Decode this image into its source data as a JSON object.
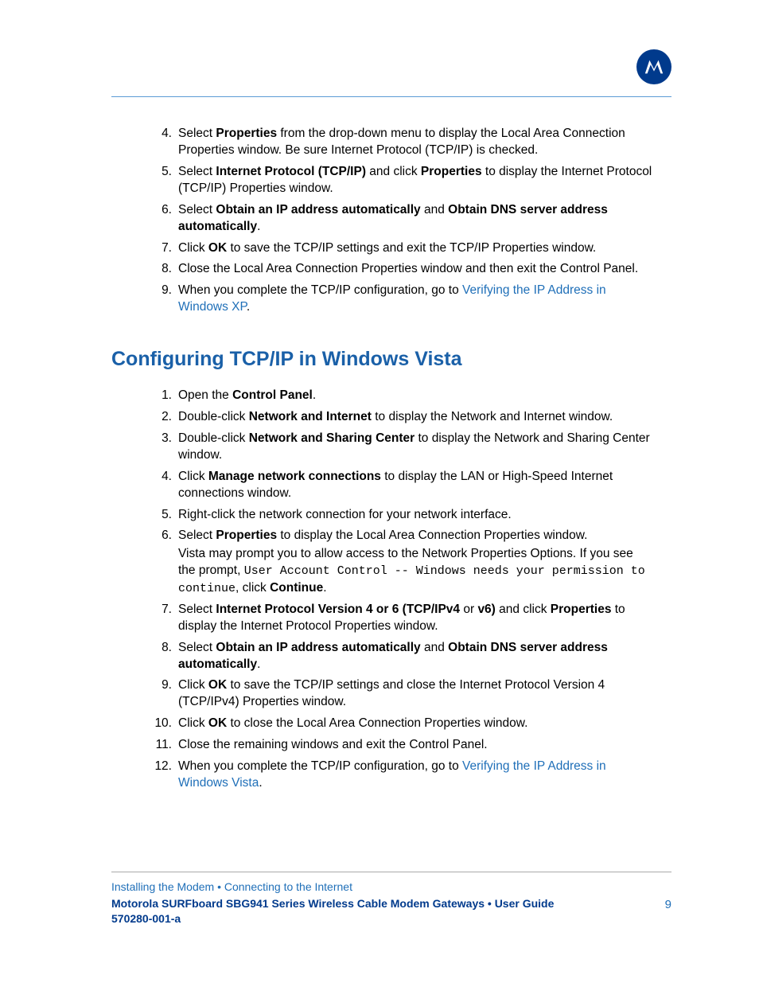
{
  "xp_steps": [
    {
      "n": "4.",
      "parts": [
        {
          "t": "Select "
        },
        {
          "t": "Properties",
          "b": 1
        },
        {
          "t": " from the drop-down menu to display the Local Area Connection Properties window. Be sure Internet Protocol (TCP/IP) is checked."
        }
      ]
    },
    {
      "n": "5.",
      "parts": [
        {
          "t": "Select "
        },
        {
          "t": "Internet Protocol (TCP/IP)",
          "b": 1
        },
        {
          "t": " and click "
        },
        {
          "t": "Properties",
          "b": 1
        },
        {
          "t": " to display the Internet Protocol (TCP/IP) Properties window."
        }
      ]
    },
    {
      "n": "6.",
      "parts": [
        {
          "t": "Select "
        },
        {
          "t": "Obtain an IP address automatically",
          "b": 1
        },
        {
          "t": " and "
        },
        {
          "t": "Obtain DNS server address automatically",
          "b": 1
        },
        {
          "t": "."
        }
      ]
    },
    {
      "n": "7.",
      "parts": [
        {
          "t": "Click "
        },
        {
          "t": "OK",
          "b": 1
        },
        {
          "t": " to save the TCP/IP settings and exit the TCP/IP Properties window."
        }
      ]
    },
    {
      "n": "8.",
      "parts": [
        {
          "t": "Close the Local Area Connection Properties window and then exit the Control Panel."
        }
      ]
    },
    {
      "n": "9.",
      "parts": [
        {
          "t": "When you complete the TCP/IP configuration, go to "
        },
        {
          "t": "Verifying the IP Address in Windows XP",
          "link": 1
        },
        {
          "t": "."
        }
      ]
    }
  ],
  "section_heading": "Configuring TCP/IP in Windows Vista",
  "vista_steps": [
    {
      "n": "1.",
      "parts": [
        {
          "t": "Open the "
        },
        {
          "t": "Control Panel",
          "b": 1
        },
        {
          "t": "."
        }
      ]
    },
    {
      "n": "2.",
      "parts": [
        {
          "t": "Double-click "
        },
        {
          "t": "Network and Internet",
          "b": 1
        },
        {
          "t": " to display the Network and Internet window."
        }
      ]
    },
    {
      "n": "3.",
      "parts": [
        {
          "t": "Double-click "
        },
        {
          "t": "Network and Sharing Center",
          "b": 1
        },
        {
          "t": " to display the Network and Sharing Center window."
        }
      ]
    },
    {
      "n": "4.",
      "parts": [
        {
          "t": "Click "
        },
        {
          "t": "Manage network connections",
          "b": 1
        },
        {
          "t": " to display the LAN or High-Speed Internet connections window."
        }
      ]
    },
    {
      "n": "5.",
      "parts": [
        {
          "t": "Right-click the network connection for your network interface."
        }
      ]
    },
    {
      "n": "6.",
      "parts": [
        {
          "t": "Select "
        },
        {
          "t": "Properties",
          "b": 1
        },
        {
          "t": " to display the Local Area Connection Properties window."
        }
      ],
      "sub": [
        {
          "t": "Vista may prompt you to allow access to the Network Properties Options. If you see the prompt, "
        },
        {
          "t": "User Account Control -- Windows needs your permission to continue",
          "mono": 1
        },
        {
          "t": ", click "
        },
        {
          "t": "Continue",
          "b": 1
        },
        {
          "t": "."
        }
      ]
    },
    {
      "n": "7.",
      "parts": [
        {
          "t": "Select "
        },
        {
          "t": "Internet Protocol Version 4 or 6 (TCP/IPv4",
          "b": 1
        },
        {
          "t": " or "
        },
        {
          "t": "v6)",
          "b": 1
        },
        {
          "t": " and click "
        },
        {
          "t": "Properties",
          "b": 1
        },
        {
          "t": " to display the Internet Protocol Properties window."
        }
      ]
    },
    {
      "n": "8.",
      "parts": [
        {
          "t": "Select "
        },
        {
          "t": "Obtain an IP address automatically",
          "b": 1
        },
        {
          "t": " and "
        },
        {
          "t": "Obtain DNS server address automatically",
          "b": 1
        },
        {
          "t": "."
        }
      ]
    },
    {
      "n": "9.",
      "parts": [
        {
          "t": "Click "
        },
        {
          "t": "OK",
          "b": 1
        },
        {
          "t": " to save the TCP/IP settings and close the Internet Protocol Version 4 (TCP/IPv4) Properties window."
        }
      ]
    },
    {
      "n": "10.",
      "parts": [
        {
          "t": "Click "
        },
        {
          "t": "OK",
          "b": 1
        },
        {
          "t": " to close the Local Area Connection Properties window."
        }
      ]
    },
    {
      "n": "11.",
      "parts": [
        {
          "t": "Close the remaining windows and exit the Control Panel."
        }
      ]
    },
    {
      "n": "12.",
      "parts": [
        {
          "t": "When you complete the TCP/IP configuration, go to "
        },
        {
          "t": "Verifying the IP Address in Windows Vista",
          "link": 1
        },
        {
          "t": "."
        }
      ]
    }
  ],
  "footer": {
    "crumb": "Installing the Modem • Connecting to the Internet",
    "title_line1": "Motorola SURFboard SBG941 Series Wireless Cable Modem Gateways • User Guide",
    "title_line2": "570280-001-a",
    "page": "9"
  }
}
